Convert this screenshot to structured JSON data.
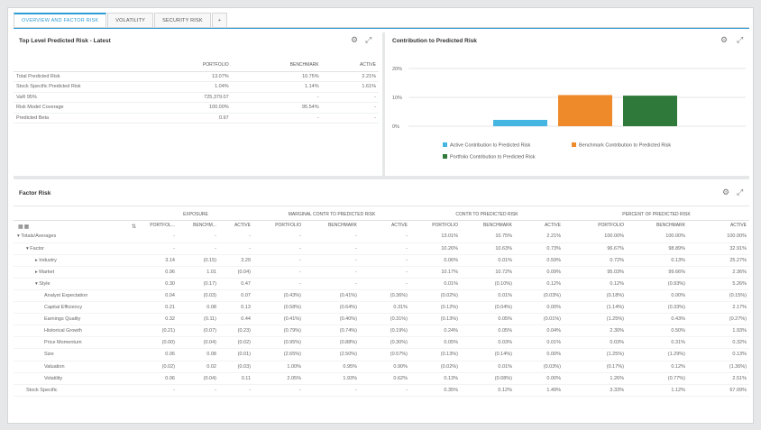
{
  "tabs": [
    {
      "label": "OVERVIEW AND FACTOR RISK"
    },
    {
      "label": "VOLATILITY"
    },
    {
      "label": "SECURITY RISK"
    },
    {
      "label": "+"
    }
  ],
  "top_risk": {
    "title": "Top Level Predicted Risk - Latest",
    "columns": [
      "PORTFOLIO",
      "BENCHMARK",
      "ACTIVE"
    ],
    "rows": [
      {
        "label": "Total Predicted Risk",
        "portfolio": "13.07%",
        "benchmark": "10.75%",
        "active": "2.21%"
      },
      {
        "label": "Stock Specific Predicted Risk",
        "portfolio": "1.04%",
        "benchmark": "1.14%",
        "active": "1.61%"
      },
      {
        "label": "VaR 95%",
        "portfolio": "725,379.07",
        "benchmark": "-",
        "active": "-"
      },
      {
        "label": "Risk Model Coverage",
        "portfolio": "100.00%",
        "benchmark": "95.54%",
        "active": "-"
      },
      {
        "label": "Predicted Beta",
        "portfolio": "0.97",
        "benchmark": "-",
        "active": "-"
      }
    ]
  },
  "contribution": {
    "title": "Contribution to Predicted Risk",
    "legend": [
      {
        "label": "Active Contribution to Predicted Risk",
        "color": "#45b5e1"
      },
      {
        "label": "Benchmark Contribution to Predicted Risk",
        "color": "#ef8a2b"
      },
      {
        "label": "Portfolio Contribution to Predicted Risk",
        "color": "#2f7a3a"
      }
    ]
  },
  "chart_data": {
    "type": "bar",
    "title": "Contribution to Predicted Risk",
    "ylim": [
      0,
      20
    ],
    "yticks": [
      "20%",
      "10%",
      "0%"
    ],
    "series": [
      {
        "name": "Active Contribution to Predicted Risk",
        "values": [
          2.2
        ]
      },
      {
        "name": "Benchmark Contribution to Predicted Risk",
        "values": [
          10.8
        ]
      },
      {
        "name": "Portfolio Contribution to Predicted Risk",
        "values": [
          10.6
        ]
      }
    ],
    "grid": true,
    "legend": "bottom"
  },
  "factor_risk": {
    "title": "Factor Risk",
    "groups": [
      "EXPOSURE",
      "MARGINAL CONTR TO PREDICTED RISK",
      "CONTR TO PREDICTED RISK",
      "PERCENT OF PREDICTED RISK"
    ],
    "columns": [
      "PORTFOL...",
      "BENCHM...",
      "ACTIVE",
      "PORTFOLIO",
      "BENCHMARK",
      "ACTIVE",
      "PORTFOLIO",
      "BENCHMARK",
      "ACTIVE",
      "PORTFOLIO",
      "BENCHMARK",
      "ACTIVE"
    ],
    "rows": [
      {
        "label": "▾ Totals/Averages",
        "indent": 0,
        "v": [
          "-",
          "-",
          "-",
          "-",
          "-",
          "-",
          "13.01%",
          "10.75%",
          "2.21%",
          "100.00%",
          "100.00%",
          "100.00%"
        ]
      },
      {
        "label": "▾ Factor",
        "indent": 1,
        "v": [
          "-",
          "-",
          "-",
          "-",
          "-",
          "-",
          "10.26%",
          "10.63%",
          "0.73%",
          "96.67%",
          "98.89%",
          "32.91%"
        ]
      },
      {
        "label": "▸ Industry",
        "indent": 2,
        "v": [
          "3.14",
          "(0.15)",
          "3.29",
          "-",
          "-",
          "-",
          "0.06%",
          "0.01%",
          "0.59%",
          "0.72%",
          "0.13%",
          "25.27%"
        ]
      },
      {
        "label": "▸ Market",
        "indent": 2,
        "v": [
          "0.96",
          "1.01",
          "(0.04)",
          "-",
          "-",
          "-",
          "10.17%",
          "10.72%",
          "0.09%",
          "95.03%",
          "99.66%",
          "2.36%"
        ]
      },
      {
        "label": "▾ Style",
        "indent": 2,
        "v": [
          "0.30",
          "(0.17)",
          "0.47",
          "-",
          "-",
          "-",
          "0.01%",
          "(0.10%)",
          "0.12%",
          "0.12%",
          "(0.93%)",
          "5.26%"
        ]
      },
      {
        "label": "Analyst Expectation",
        "indent": 3,
        "v": [
          "0.04",
          "(0.03)",
          "0.07",
          "(0.43%)",
          "(0.41%)",
          "(0.36%)",
          "(0.02%)",
          "0.01%",
          "(0.03%)",
          "(0.18%)",
          "0.00%",
          "(0.15%)"
        ]
      },
      {
        "label": "Capital Efficiency",
        "indent": 3,
        "v": [
          "0.21",
          "0.08",
          "0.13",
          "(0.58%)",
          "(0.64%)",
          "0.31%",
          "(0.12%)",
          "(0.04%)",
          "0.00%",
          "(1.14%)",
          "(0.33%)",
          "2.17%"
        ]
      },
      {
        "label": "Earnings Quality",
        "indent": 3,
        "v": [
          "0.32",
          "(0.11)",
          "0.44",
          "(0.41%)",
          "(0.40%)",
          "(0.31%)",
          "(0.13%)",
          "0.05%",
          "(0.01%)",
          "(1.25%)",
          "0.43%",
          "(0.27%)"
        ]
      },
      {
        "label": "Historical Growth",
        "indent": 3,
        "v": [
          "(0.21)",
          "(0.07)",
          "(0.23)",
          "(0.79%)",
          "(0.74%)",
          "(0.19%)",
          "0.24%",
          "0.05%",
          "0.04%",
          "2.30%",
          "0.50%",
          "1.93%"
        ]
      },
      {
        "label": "Price Momentum",
        "indent": 3,
        "v": [
          "(0.00)",
          "(0.04)",
          "(0.02)",
          "(0.95%)",
          "(0.88%)",
          "(0.30%)",
          "0.05%",
          "0.03%",
          "0.01%",
          "0.03%",
          "0.31%",
          "0.32%"
        ]
      },
      {
        "label": "Size",
        "indent": 3,
        "v": [
          "0.06",
          "0.08",
          "(0.01)",
          "(2.65%)",
          "(2.50%)",
          "(0.57%)",
          "(0.13%)",
          "(0.14%)",
          "0.00%",
          "(1.25%)",
          "(1.29%)",
          "0.13%"
        ]
      },
      {
        "label": "Valuation",
        "indent": 3,
        "v": [
          "(0.02)",
          "0.02",
          "(0.03)",
          "1.00%",
          "0.95%",
          "0.90%",
          "(0.02%)",
          "0.01%",
          "(0.03%)",
          "(0.17%)",
          "0.12%",
          "(1.36%)"
        ]
      },
      {
        "label": "Volatility",
        "indent": 3,
        "v": [
          "0.06",
          "(0.04)",
          "0.11",
          "2.05%",
          "1.93%",
          "0.62%",
          "0.13%",
          "(0.08%)",
          "0.00%",
          "1.26%",
          "(0.77%)",
          "2.51%"
        ]
      },
      {
        "label": "Stock Specific",
        "indent": 1,
        "v": [
          "-",
          "-",
          "-",
          "-",
          "-",
          "-",
          "0.35%",
          "0.12%",
          "1.49%",
          "3.33%",
          "1.12%",
          "67.09%"
        ]
      }
    ]
  },
  "icons": {
    "settings": "⚙",
    "expand": "⤢",
    "grid": "▦▦",
    "sort": "⇅"
  }
}
